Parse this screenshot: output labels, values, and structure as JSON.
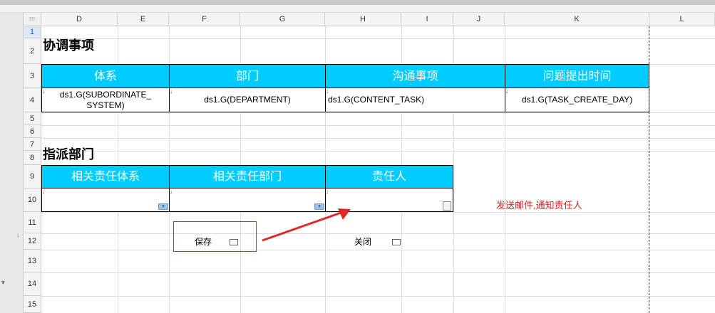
{
  "sheet": {
    "corner_icon": "grid-dots-icon",
    "columns": [
      "D",
      "E",
      "F",
      "G",
      "H",
      "I",
      "J",
      "K",
      "L"
    ],
    "rows": [
      "1",
      "2",
      "3",
      "4",
      "5",
      "6",
      "7",
      "8",
      "9",
      "10",
      "11",
      "12",
      "13",
      "14",
      "15"
    ]
  },
  "section1": {
    "title": "协调事项",
    "headers": [
      "体系",
      "部门",
      "沟通事项",
      "问题提出时间"
    ],
    "values": [
      "ds1.G(SUBORDINATE_\nSYSTEM)",
      "ds1.G(DEPARTMENT)",
      "ds1.G(CONTENT_TASK)",
      "ds1.G(TASK_CREATE_DAY)"
    ]
  },
  "section2": {
    "title": "指派部门",
    "headers": [
      "相关责任体系",
      "相关责任部门",
      "责任人"
    ]
  },
  "buttons": {
    "save": "保存",
    "close": "关闭"
  },
  "annotation": {
    "note": "发送邮件,通知责任人",
    "color": "#e02020"
  },
  "colors": {
    "header_fill": "#00ccff",
    "header_text": "#ffffff"
  }
}
